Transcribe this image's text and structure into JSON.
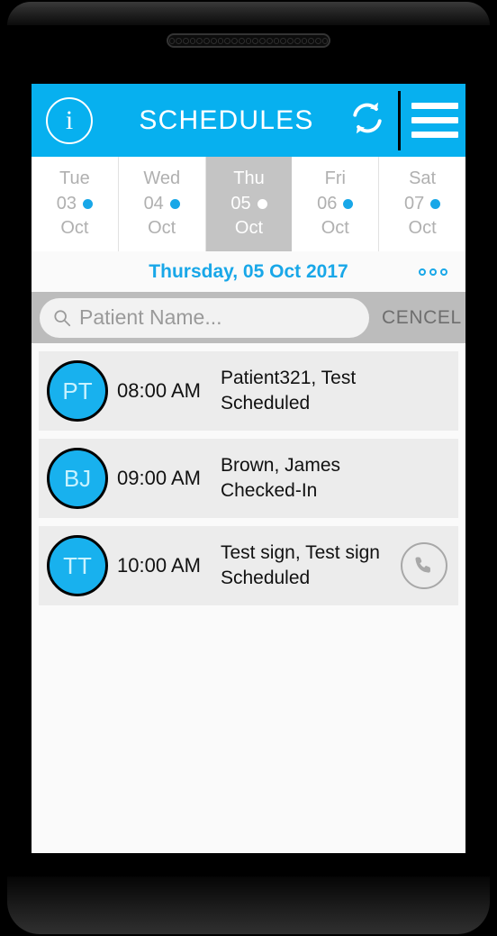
{
  "device": {
    "speaker_holes": 23
  },
  "appbar": {
    "info_icon": "info-icon",
    "info_glyph": "i",
    "title": "SCHEDULES",
    "refresh_icon": "refresh-icon",
    "menu_icon": "hamburger-menu-icon",
    "bg_color": "#07b0ef"
  },
  "datestrip": {
    "days": [
      {
        "weekday": "Tue",
        "day": "03",
        "month": "Oct",
        "selected": false,
        "has_dot": true
      },
      {
        "weekday": "Wed",
        "day": "04",
        "month": "Oct",
        "selected": false,
        "has_dot": true
      },
      {
        "weekday": "Thu",
        "day": "05",
        "month": "Oct",
        "selected": true,
        "has_dot": true
      },
      {
        "weekday": "Fri",
        "day": "06",
        "month": "Oct",
        "selected": false,
        "has_dot": true
      },
      {
        "weekday": "Sat",
        "day": "07",
        "month": "Oct",
        "selected": false,
        "has_dot": true
      }
    ],
    "selected_bg": "#c4c4c4",
    "dot_color": "#18a7e8"
  },
  "date_header": {
    "title": "Thursday, 05 Oct 2017",
    "color": "#18a7e8",
    "overflow_icon": "more-options-icon"
  },
  "search": {
    "placeholder": "Patient Name...",
    "value": "",
    "search_icon": "search-icon",
    "cancel_label": "CENCEL",
    "bar_bg": "#bcbcbc"
  },
  "appointments": [
    {
      "initials": "PT",
      "time": "08:00 AM",
      "name": "Patient321, Test",
      "status": "Scheduled",
      "has_call": false
    },
    {
      "initials": "BJ",
      "time": "09:00 AM",
      "name": "Brown, James",
      "status": "Checked-In",
      "has_call": false
    },
    {
      "initials": "TT",
      "time": "10:00 AM",
      "name": "Test sign, Test sign",
      "status": "Scheduled",
      "has_call": true,
      "call_icon": "phone-icon"
    }
  ],
  "colors": {
    "accent": "#18a7e8",
    "avatar_fill": "#18b1ee",
    "card_bg": "#ececec",
    "screen_bg": "#fafafa"
  }
}
